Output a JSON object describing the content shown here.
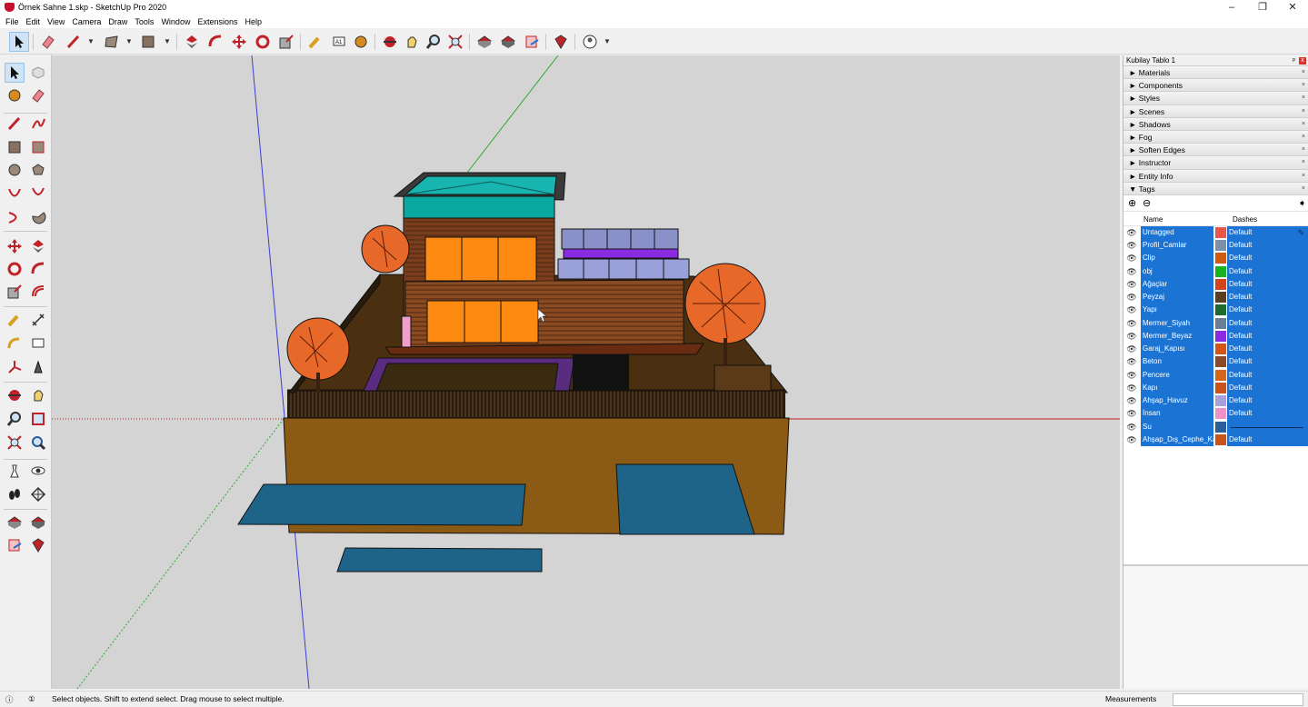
{
  "window": {
    "title": "Örnek Sahne 1.skp - SketchUp Pro 2020",
    "controls": [
      "–",
      "❐",
      "✕"
    ]
  },
  "menu": [
    "File",
    "Edit",
    "View",
    "Camera",
    "Draw",
    "Tools",
    "Window",
    "Extensions",
    "Help"
  ],
  "icons": {
    "top_toolbar": [
      "select-icon",
      "eraser-icon",
      "pencil-icon",
      "rectangle-icon",
      "paint-bucket-icon",
      "push-pull-icon",
      "follow-me-icon",
      "move-icon",
      "rotate-icon",
      "scale-icon",
      "tape-measure-icon",
      "text-icon",
      "paint-icon",
      "orbit-icon",
      "pan-icon",
      "zoom-icon",
      "zoom-extents-icon",
      "warehouse-icon",
      "extension-warehouse-icon",
      "layout-icon",
      "ruby-icon",
      "account-icon"
    ],
    "left_toolbar": [
      "select-icon",
      "make-component-icon",
      "paint-bucket-icon",
      "eraser-icon",
      "line-icon",
      "freehand-icon",
      "rectangle-icon",
      "rotated-rectangle-icon",
      "circle-icon",
      "polygon-icon",
      "arc-icon",
      "two-point-arc-icon",
      "three-point-arc-icon",
      "pie-icon",
      "move-icon",
      "push-pull-icon",
      "rotate-icon",
      "follow-me-icon",
      "scale-icon",
      "offset-icon",
      "tape-measure-icon",
      "dimension-icon",
      "protractor-icon",
      "text-icon",
      "axes-icon",
      "3d-text-icon",
      "orbit-icon",
      "pan-icon",
      "zoom-icon",
      "zoom-window-icon",
      "zoom-extents-icon",
      "previous-view-icon",
      "position-camera-icon",
      "look-around-icon",
      "walk-icon",
      "section-plane-icon",
      "warehouse-icon",
      "extension-warehouse-icon",
      "layout-icon",
      "ruby-icon"
    ]
  },
  "tray": {
    "title": "Kubilay Tablo 1",
    "pin": "ᵖ",
    "close": "x",
    "panels": [
      "Materials",
      "Components",
      "Styles",
      "Scenes",
      "Shadows",
      "Fog",
      "Soften Edges",
      "Instructor",
      "Entity Info"
    ],
    "tags_panel": "Tags",
    "collapsed_marker": "►",
    "expanded_marker": "▼",
    "panel_close": "×",
    "tag_tools": {
      "add": "⊕",
      "remove": "⊖",
      "details": "➧"
    },
    "columns": {
      "name": "Name",
      "dashes": "Dashes"
    },
    "tags": [
      {
        "name": "Untagged",
        "color": "#e8584a",
        "dashes": "Default"
      },
      {
        "name": "Profil_Camlar",
        "color": "#7f8fa8",
        "dashes": "Default"
      },
      {
        "name": "Clip",
        "color": "#d15a12",
        "dashes": "Default"
      },
      {
        "name": "obj",
        "color": "#18b41e",
        "dashes": "Default"
      },
      {
        "name": "Ağaçlar",
        "color": "#d2451c",
        "dashes": "Default"
      },
      {
        "name": "Peyzaj",
        "color": "#5a4020",
        "dashes": "Default"
      },
      {
        "name": "Yapı",
        "color": "#1f6b2e",
        "dashes": "Default"
      },
      {
        "name": "Mermer_Siyah",
        "color": "#6a7f96",
        "dashes": "Default"
      },
      {
        "name": "Mermer_Beyaz",
        "color": "#8a2be2",
        "dashes": "Default"
      },
      {
        "name": "Garaj_Kapısı",
        "color": "#d6541a",
        "dashes": "Default"
      },
      {
        "name": "Beton",
        "color": "#8b4a2a",
        "dashes": "Default"
      },
      {
        "name": "Pencere",
        "color": "#d6661e",
        "dashes": "Default"
      },
      {
        "name": "Kapı",
        "color": "#c8541c",
        "dashes": "Default"
      },
      {
        "name": "Ahşap_Havuz",
        "color": "#a8a0d8",
        "dashes": "Default"
      },
      {
        "name": "İnsan",
        "color": "#f090c8",
        "dashes": "Default"
      },
      {
        "name": "Su",
        "color": "#2a5e9a",
        "dashes": ""
      },
      {
        "name": "Ahşap_Dış_Cephe_Ka",
        "color": "#c8541c",
        "dashes": "Default"
      }
    ],
    "eye_icon": "👁",
    "edit_icon": "✎"
  },
  "status": {
    "icons": [
      "ⓘ",
      "①"
    ],
    "hint": "Select objects. Shift to extend select. Drag mouse to select multiple.",
    "measurements_label": "Measurements",
    "measurements_value": ""
  }
}
